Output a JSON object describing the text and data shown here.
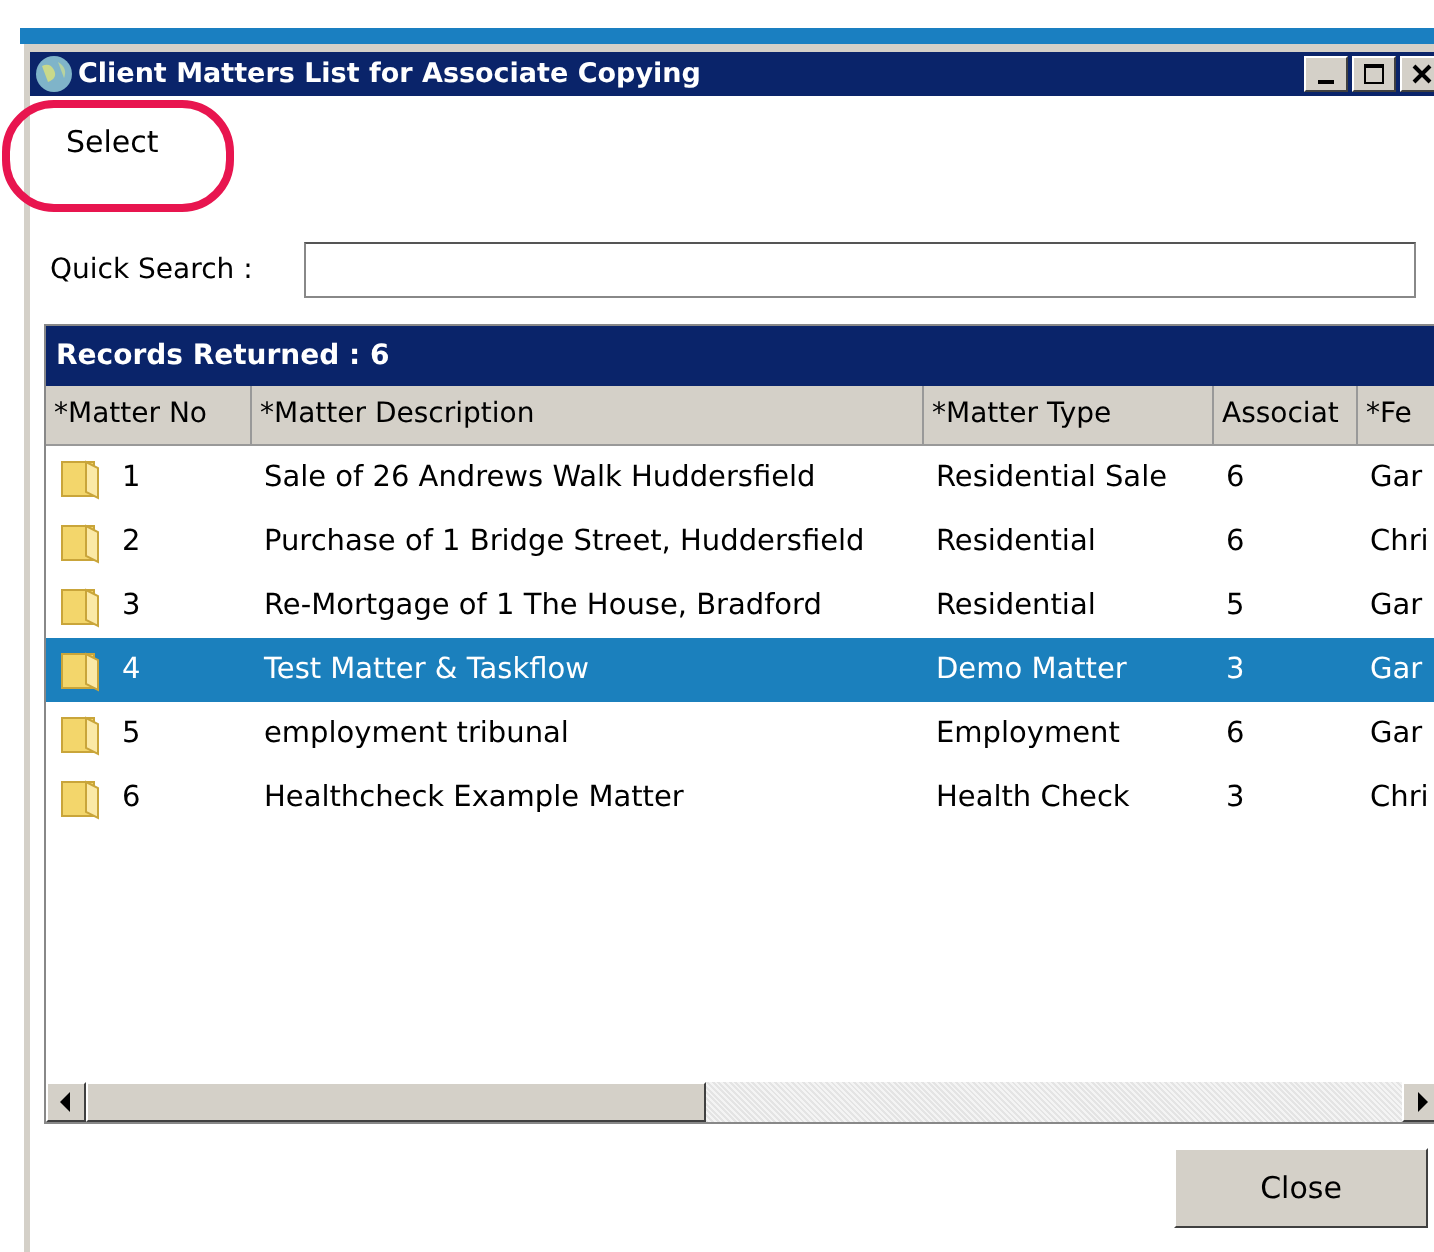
{
  "window": {
    "title": "Client Matters List for Associate Copying"
  },
  "toolbar": {
    "select_label": "Select"
  },
  "search": {
    "label": "Quick Search :"
  },
  "table": {
    "caption": "Records Returned : 6",
    "columns": [
      "*Matter No",
      "*Matter Description",
      "*Matter Type",
      "Associat",
      "*Fe"
    ],
    "rows": [
      {
        "cells": [
          "1",
          "Sale of 26 Andrews Walk  Huddersfield",
          "Residential Sale",
          "6",
          "Gar"
        ],
        "selected": false
      },
      {
        "cells": [
          "2",
          "Purchase of 1 Bridge Street, Huddersfield",
          "Residential",
          "6",
          "Chri"
        ],
        "selected": false
      },
      {
        "cells": [
          "3",
          "Re-Mortgage of 1 The House, Bradford",
          "Residential",
          "5",
          "Gar"
        ],
        "selected": false
      },
      {
        "cells": [
          "4",
          "Test Matter & Taskflow",
          "Demo Matter",
          "3",
          "Gar"
        ],
        "selected": true
      },
      {
        "cells": [
          "5",
          "employment tribunal",
          "Employment",
          "6",
          "Gar"
        ],
        "selected": false
      },
      {
        "cells": [
          "6",
          "Healthcheck Example Matter",
          "Health Check",
          "3",
          "Chri"
        ],
        "selected": false
      }
    ]
  },
  "buttons": [
    "Close"
  ]
}
